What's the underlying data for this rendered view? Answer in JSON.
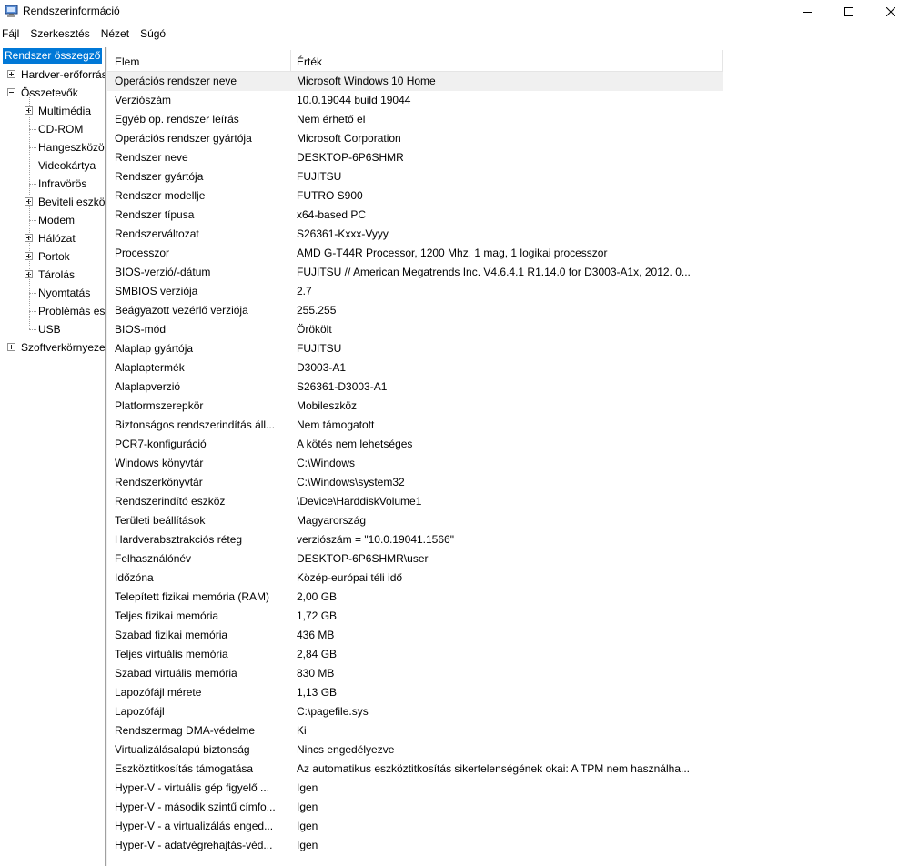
{
  "window": {
    "title": "Rendszerinformáció",
    "icon": "system-information-icon"
  },
  "menu": [
    "Fájl",
    "Szerkesztés",
    "Nézet",
    "Súgó"
  ],
  "tree": [
    {
      "label": "Rendszer összegző",
      "level": 0,
      "expander": "none",
      "selected": true
    },
    {
      "label": "Hardver-erőforrások",
      "level": 0,
      "expander": "plus"
    },
    {
      "label": "Összetevők",
      "level": 0,
      "expander": "minus"
    },
    {
      "label": "Multimédia",
      "level": 1,
      "expander": "plus"
    },
    {
      "label": "CD-ROM",
      "level": 1,
      "expander": "none"
    },
    {
      "label": "Hangeszközök",
      "level": 1,
      "expander": "none"
    },
    {
      "label": "Videokártya",
      "level": 1,
      "expander": "none"
    },
    {
      "label": "Infravörös",
      "level": 1,
      "expander": "none"
    },
    {
      "label": "Beviteli eszközök",
      "level": 1,
      "expander": "plus"
    },
    {
      "label": "Modem",
      "level": 1,
      "expander": "none"
    },
    {
      "label": "Hálózat",
      "level": 1,
      "expander": "plus"
    },
    {
      "label": "Portok",
      "level": 1,
      "expander": "plus"
    },
    {
      "label": "Tárolás",
      "level": 1,
      "expander": "plus"
    },
    {
      "label": "Nyomtatás",
      "level": 1,
      "expander": "none"
    },
    {
      "label": "Problémás eszközök",
      "level": 1,
      "expander": "none"
    },
    {
      "label": "USB",
      "level": 1,
      "expander": "none"
    },
    {
      "label": "Szoftverkörnyezet",
      "level": 0,
      "expander": "plus"
    }
  ],
  "columns": {
    "item": "Elem",
    "value": "Érték"
  },
  "rows": [
    [
      "Operációs rendszer neve",
      "Microsoft Windows 10 Home"
    ],
    [
      "Verziószám",
      "10.0.19044 build 19044"
    ],
    [
      "Egyéb op. rendszer leírás",
      "Nem érhető el"
    ],
    [
      "Operációs rendszer gyártója",
      "Microsoft Corporation"
    ],
    [
      "Rendszer neve",
      "DESKTOP-6P6SHMR"
    ],
    [
      "Rendszer gyártója",
      "FUJITSU"
    ],
    [
      "Rendszer modellje",
      "FUTRO S900"
    ],
    [
      "Rendszer típusa",
      "x64-based PC"
    ],
    [
      "Rendszerváltozat",
      "S26361-Kxxx-Vyyy"
    ],
    [
      "Processzor",
      "AMD G-T44R Processor, 1200 Mhz, 1 mag, 1 logikai processzor"
    ],
    [
      "BIOS-verzió/-dátum",
      "FUJITSU // American Megatrends Inc. V4.6.4.1 R1.14.0 for D3003-A1x, 2012. 0..."
    ],
    [
      "SMBIOS verziója",
      "2.7"
    ],
    [
      "Beágyazott vezérlő verziója",
      "255.255"
    ],
    [
      "BIOS-mód",
      "Örökölt"
    ],
    [
      "Alaplap gyártója",
      "FUJITSU"
    ],
    [
      "Alaplaptermék",
      "D3003-A1"
    ],
    [
      "Alaplapverzió",
      "S26361-D3003-A1"
    ],
    [
      "Platformszerepkör",
      "Mobileszköz"
    ],
    [
      "Biztonságos rendszerindítás áll...",
      "Nem támogatott"
    ],
    [
      "PCR7-konfiguráció",
      "A kötés nem lehetséges"
    ],
    [
      "Windows könyvtár",
      "C:\\Windows"
    ],
    [
      "Rendszerkönyvtár",
      "C:\\Windows\\system32"
    ],
    [
      "Rendszerindító eszköz",
      "\\Device\\HarddiskVolume1"
    ],
    [
      "Területi beállítások",
      "Magyarország"
    ],
    [
      "Hardverabsztrakciós réteg",
      "verziószám = \"10.0.19041.1566\""
    ],
    [
      "Felhasználónév",
      "DESKTOP-6P6SHMR\\user"
    ],
    [
      "Időzóna",
      "Közép-európai téli idő"
    ],
    [
      "Telepített fizikai memória (RAM)",
      "2,00 GB"
    ],
    [
      "Teljes fizikai memória",
      "1,72 GB"
    ],
    [
      "Szabad fizikai memória",
      "436 MB"
    ],
    [
      "Teljes virtuális memória",
      "2,84 GB"
    ],
    [
      "Szabad virtuális memória",
      "830 MB"
    ],
    [
      "Lapozófájl mérete",
      "1,13 GB"
    ],
    [
      "Lapozófájl",
      "C:\\pagefile.sys"
    ],
    [
      "Rendszermag DMA-védelme",
      "Ki"
    ],
    [
      "Virtualizálásalapú biztonság",
      "Nincs engedélyezve"
    ],
    [
      "Eszköztitkosítás támogatása",
      "Az automatikus eszköztitkosítás sikertelenségének okai: A TPM nem használha..."
    ],
    [
      "Hyper-V - virtuális gép figyelő ...",
      "Igen"
    ],
    [
      "Hyper-V - második szintű címfo...",
      "Igen"
    ],
    [
      "Hyper-V - a virtualizálás enged...",
      "Igen"
    ],
    [
      "Hyper-V - adatvégrehajtás-véd...",
      "Igen"
    ]
  ]
}
